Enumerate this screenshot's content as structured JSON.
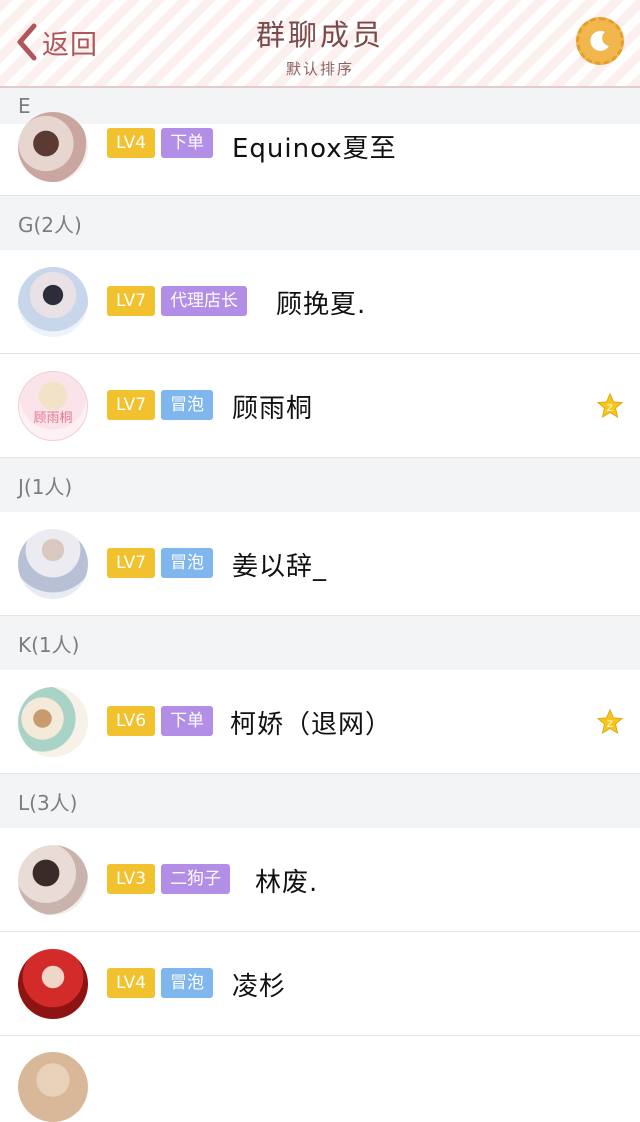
{
  "header": {
    "back_label": "返回",
    "title": "群聊成员",
    "subtitle": "默认排序"
  },
  "colors": {
    "accent": "#b0555a",
    "lv_badge": "#f2c12e",
    "role_purple": "#b28ee6",
    "role_blue": "#7fb6ee",
    "section_bg": "#f3f4f5",
    "star": "#f7c61c"
  },
  "sections": [
    {
      "label": "E"
    },
    {
      "label": "G(2人)"
    },
    {
      "label": "J(1人)"
    },
    {
      "label": "K(1人)"
    },
    {
      "label": "L(3人)"
    }
  ],
  "members": [
    {
      "level": "LV4",
      "role": "下单",
      "role_color": "purple",
      "name": "Equinox夏至",
      "starred": false,
      "avatar": "avatar-image"
    },
    {
      "level": "LV7",
      "role": "代理店长",
      "role_color": "purple",
      "name": "顾挽夏.",
      "starred": false,
      "avatar": "avatar-image"
    },
    {
      "level": "LV7",
      "role": "冒泡",
      "role_color": "blue",
      "name": "顾雨桐",
      "starred": true,
      "avatar": "avatar-image",
      "avatar_text": "顾雨桐"
    },
    {
      "level": "LV7",
      "role": "冒泡",
      "role_color": "blue",
      "name": "姜以辞_",
      "starred": false,
      "avatar": "avatar-image"
    },
    {
      "level": "LV6",
      "role": "下单",
      "role_color": "purple",
      "name": "柯娇（退网）",
      "starred": true,
      "avatar": "avatar-image"
    },
    {
      "level": "LV3",
      "role": "二狗子",
      "role_color": "purple",
      "name": "林废.",
      "starred": false,
      "avatar": "avatar-image"
    },
    {
      "level": "LV4",
      "role": "冒泡",
      "role_color": "blue",
      "name": "凌杉",
      "starred": false,
      "avatar": "avatar-image"
    }
  ],
  "icons": {
    "back": "chevron-left-icon",
    "moon": "moon-icon",
    "star": "star-icon"
  }
}
